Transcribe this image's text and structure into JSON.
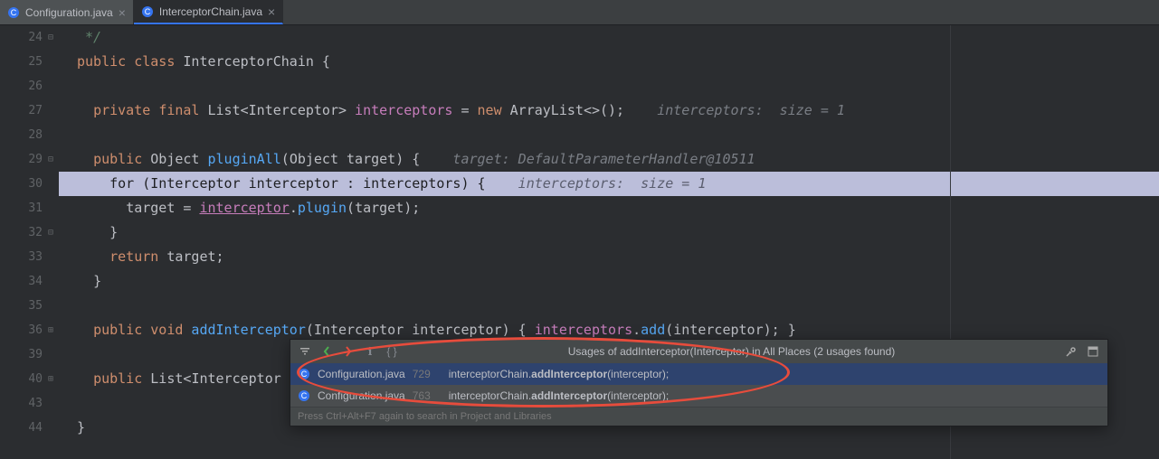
{
  "tabs": [
    {
      "label": "Configuration.java"
    },
    {
      "label": "InterceptorChain.java"
    }
  ],
  "gutter": [
    "24",
    "25",
    "26",
    "27",
    "28",
    "29",
    "30",
    "31",
    "32",
    "33",
    "34",
    "35",
    "36",
    "39",
    "40",
    "43",
    "44"
  ],
  "code": {
    "l24_comment": " */",
    "l25_kw1": "public",
    "l25_kw2": "class",
    "l25_name": "InterceptorChain",
    "l25_brace": " {",
    "l27_kw1": "private",
    "l27_kw2": "final",
    "l27_type1": "List",
    "l27_lt": "<",
    "l27_type2": "Interceptor",
    "l27_gt": ">",
    "l27_field": " interceptors",
    "l27_eq": " = ",
    "l27_kw3": "new",
    "l27_type3": " ArrayList",
    "l27_diamond": "<>",
    "l27_tail": "();",
    "l27_comment": "  interceptors:  size = 1",
    "l29_kw1": "public",
    "l29_type1": "Object",
    "l29_method": " pluginAll",
    "l29_paren": "(",
    "l29_type2": "Object",
    "l29_param": " target",
    "l29_close": ") {",
    "l29_comment": "  target: DefaultParameterHandler@10511",
    "l30_kw": "for",
    "l30_open": " (",
    "l30_type": "Interceptor",
    "l30_var": " interceptor",
    "l30_colon": " : ",
    "l30_field": "interceptors",
    "l30_close": ") {",
    "l30_comment": "  interceptors:  size = 1",
    "l31_var": "target",
    "l31_eq": " = ",
    "l31_ref": "interceptor",
    "l31_dot": ".",
    "l31_method": "plugin",
    "l31_paren": "(",
    "l31_arg": "target",
    "l31_close": ");",
    "l32_brace": "}",
    "l33_kw": "return",
    "l33_var": " target",
    "l33_semi": ";",
    "l34_brace": "}",
    "l36_kw1": "public",
    "l36_kw2": "void",
    "l36_method": " addInterceptor",
    "l36_paren": "(",
    "l36_type": "Interceptor",
    "l36_param": " interceptor",
    "l36_mid": ") { ",
    "l36_field": "interceptors",
    "l36_dot": ".",
    "l36_call": "add",
    "l36_arg_open": "(",
    "l36_arg": "interceptor",
    "l36_tail": "); }",
    "l40_kw": "public",
    "l40_type1": " List",
    "l40_lt": "<",
    "l40_type2": "Interceptor",
    "l44_brace": "}"
  },
  "popup": {
    "title": "Usages of addInterceptor(Interceptor) in All Places (2 usages found)",
    "rows": [
      {
        "file": "Configuration.java",
        "line": "729",
        "prefix": "interceptorChain.",
        "bold": "addInterceptor",
        "suffix": "(interceptor);"
      },
      {
        "file": "Configuration.java",
        "line": "763",
        "prefix": "interceptorChain.",
        "bold": "addInterceptor",
        "suffix": "(interceptor);"
      }
    ],
    "footer": "Press Ctrl+Alt+F7 again to search in Project and Libraries"
  }
}
